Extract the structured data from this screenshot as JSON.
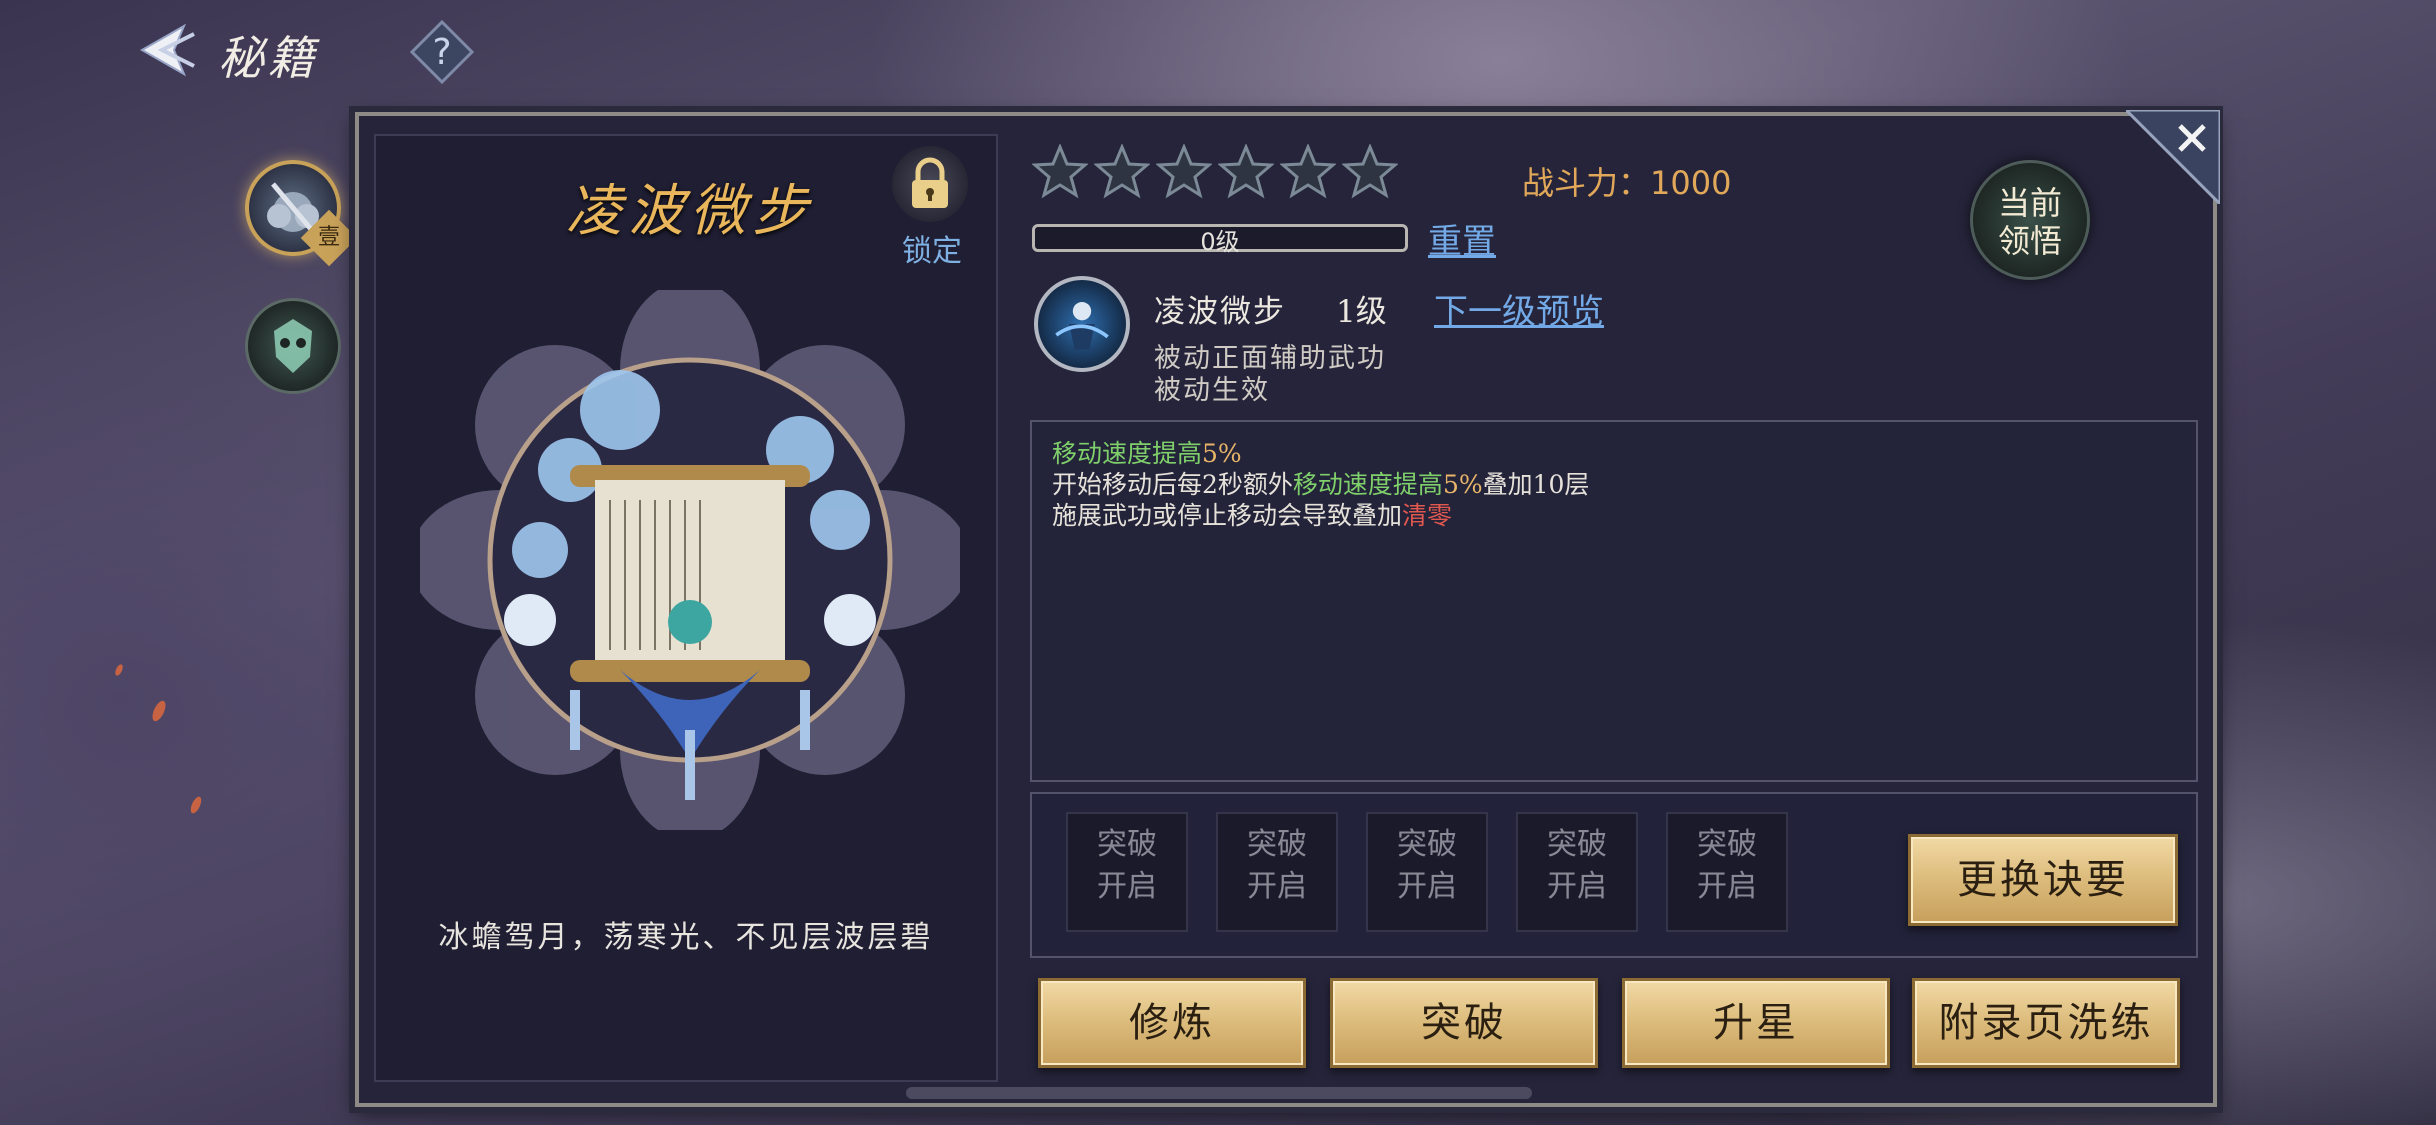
{
  "header": {
    "title": "秘籍"
  },
  "book": {
    "title": "凌波微步",
    "lock_label": "锁定",
    "quote": "冰蟾驾月，荡寒光、不见层波层碧"
  },
  "stars": {
    "total": 6,
    "lit": 0
  },
  "power": {
    "label": "战斗力：",
    "value": "1000"
  },
  "exp": {
    "label": "0级",
    "progress": 0
  },
  "reset_label": "重置",
  "insight_label": [
    "当前",
    "领悟"
  ],
  "skill": {
    "name": "凌波微步",
    "level": "1级",
    "next_preview": "下一级预览",
    "type": "被动正面辅助武功",
    "effect": "被动生效"
  },
  "description": {
    "line1": {
      "a": "移动速度提高",
      "b": "5%"
    },
    "line2": {
      "a": "开始移动后每",
      "b": "2秒额外",
      "c": "移动速度提高",
      "d": "5%",
      "e": "叠加10层"
    },
    "line3": {
      "a": "施展武功或停止移动会导致叠加",
      "b": "清零"
    }
  },
  "breakthrough": {
    "slots": [
      {
        "line1": "突破",
        "line2": "开启"
      },
      {
        "line1": "突破",
        "line2": "开启"
      },
      {
        "line1": "突破",
        "line2": "开启"
      },
      {
        "line1": "突破",
        "line2": "开启"
      },
      {
        "line1": "突破",
        "line2": "开启"
      }
    ],
    "swap_label": "更换诀要"
  },
  "actions": {
    "cultivate": "修炼",
    "break": "突破",
    "star_up": "升星",
    "appendix_refine": "附录页洗练"
  },
  "tab_badge": "壹",
  "colors": {
    "gold": "#e9b65b",
    "link": "#72a9e6",
    "green": "#7fd06a",
    "red": "#e0584e"
  }
}
